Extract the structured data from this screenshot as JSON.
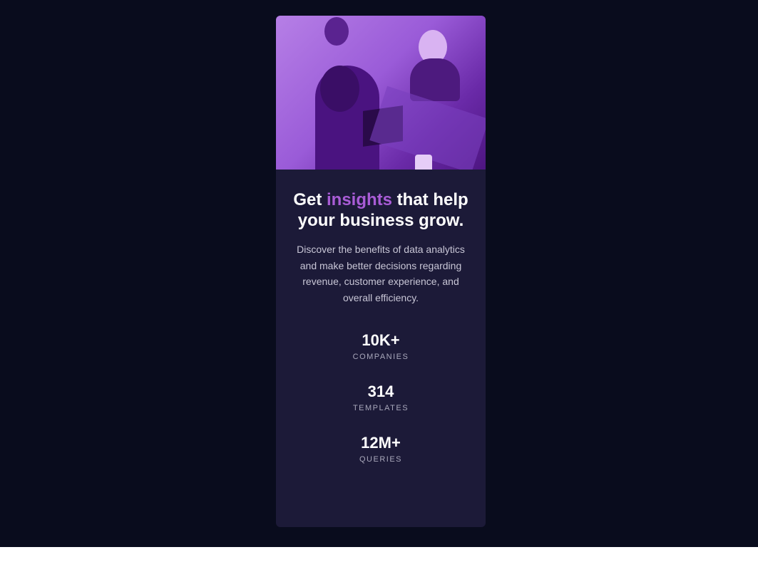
{
  "card": {
    "image_alt": "People working at desks",
    "title_before": "Get ",
    "title_accent": "insights",
    "title_after": " that help your business grow.",
    "description": "Discover the benefits of data analytics and make better decisions regarding revenue, customer experience, and overall efficiency.",
    "stats": [
      {
        "value": "10K+",
        "label": "COMPANIES"
      },
      {
        "value": "314",
        "label": "TEMPLATES"
      },
      {
        "value": "12M+",
        "label": "QUERIES"
      }
    ]
  },
  "colors": {
    "background": "#090c1d",
    "card": "#1c1a38",
    "accent": "#a95cd6",
    "overlay": "#9a5bd8"
  }
}
